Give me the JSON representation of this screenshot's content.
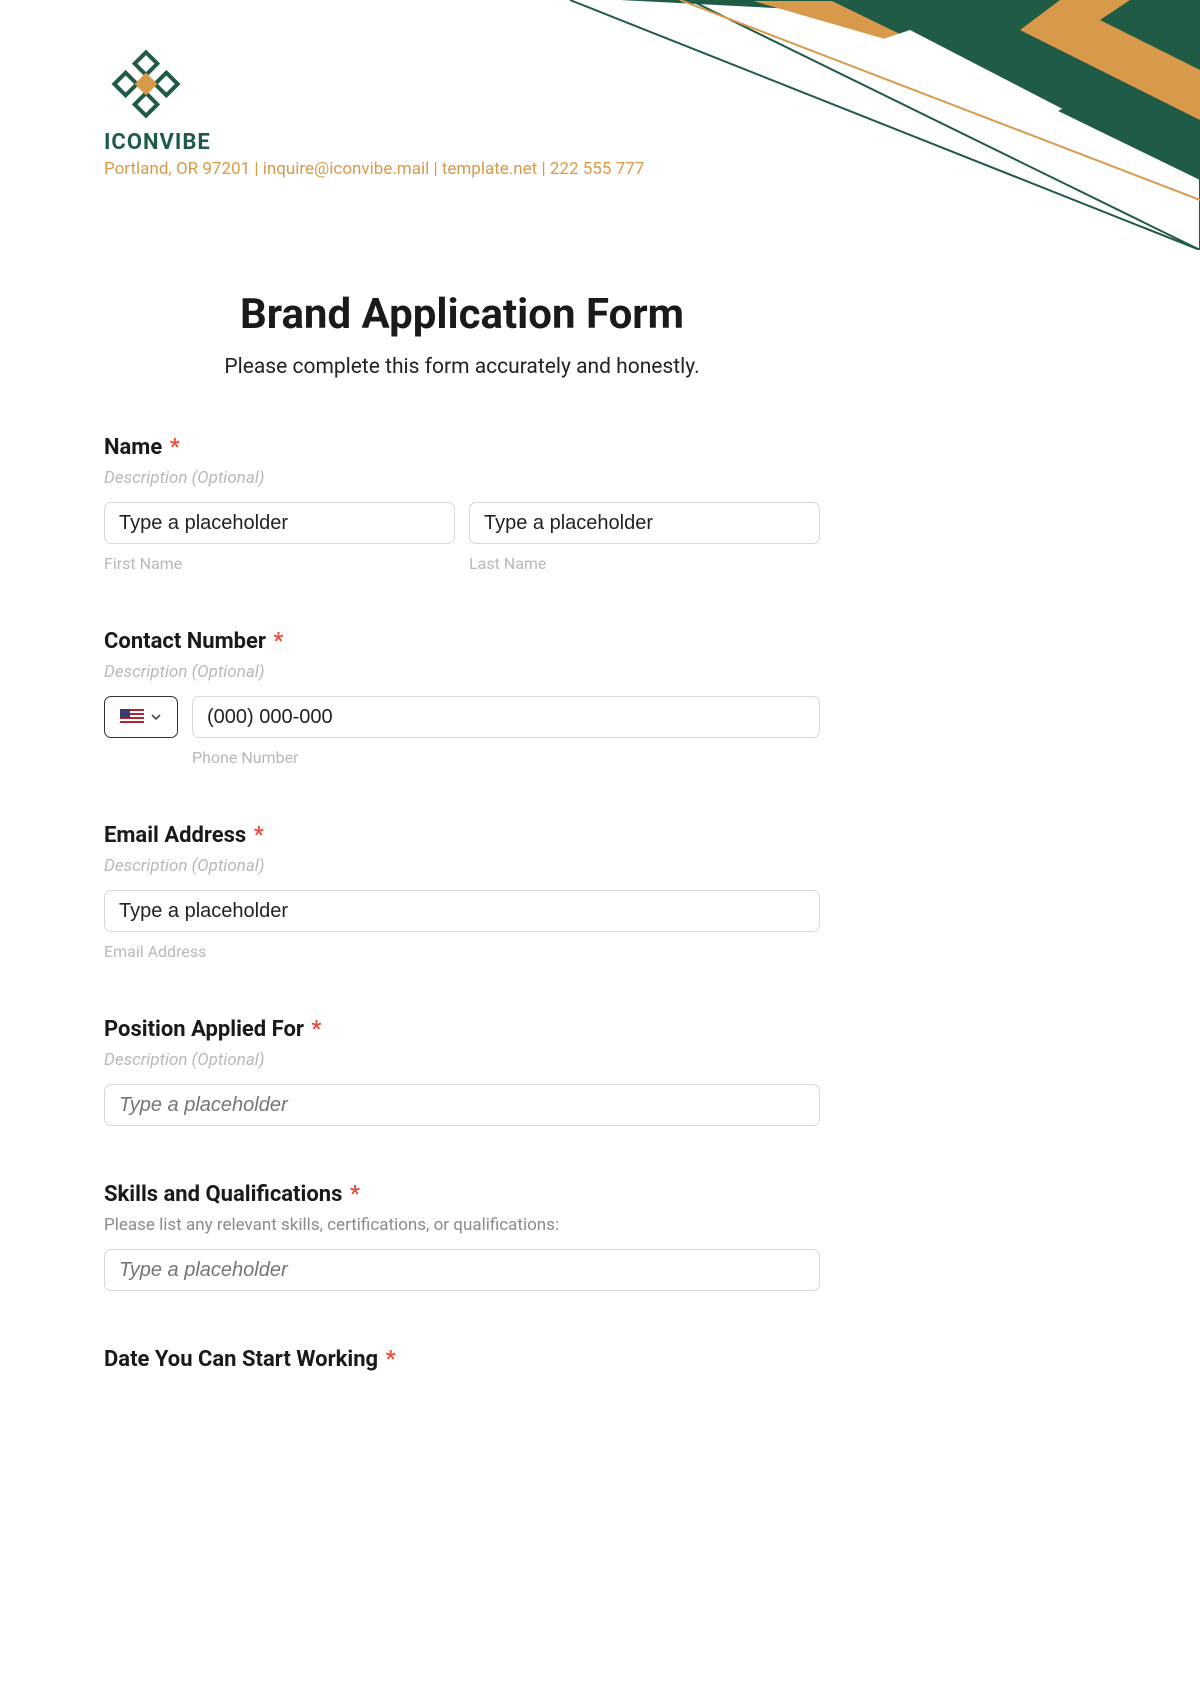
{
  "brand": {
    "name": "ICONVIBE",
    "contact_line": "Portland, OR 97201 | inquire@iconvibe.mail | template.net | 222 555 777"
  },
  "form": {
    "title": "Brand Application Form",
    "subtitle": "Please complete this form accurately and honestly."
  },
  "fields": {
    "name": {
      "label": "Name",
      "required": "*",
      "desc": "Description (Optional)",
      "first_placeholder": "Type a placeholder",
      "last_placeholder": "Type a placeholder",
      "first_sub": "First Name",
      "last_sub": "Last Name"
    },
    "contact_number": {
      "label": "Contact Number",
      "required": "*",
      "desc": "Description (Optional)",
      "placeholder": "(000) 000-000",
      "sub": "Phone Number"
    },
    "email": {
      "label": "Email Address",
      "required": "*",
      "desc": "Description (Optional)",
      "placeholder": "Type a placeholder",
      "sub": "Email Address"
    },
    "position": {
      "label": "Position Applied For",
      "required": "*",
      "desc": "Description (Optional)",
      "placeholder": "Type a placeholder"
    },
    "skills": {
      "label": "Skills and Qualifications",
      "required": "*",
      "desc": "Please list any relevant skills, certifications, or qualifications:",
      "placeholder": "Type a placeholder"
    },
    "start_date": {
      "label": "Date You Can Start Working",
      "required": "*"
    }
  }
}
